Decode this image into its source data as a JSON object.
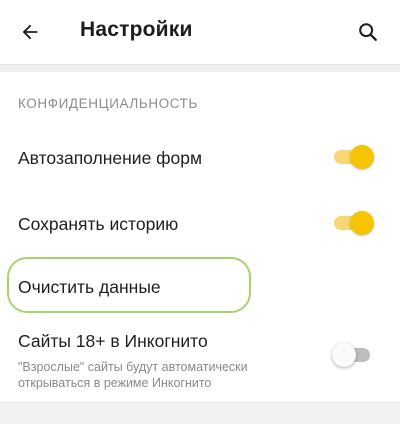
{
  "header": {
    "title": "Настройки",
    "back_icon": "arrow-left-icon",
    "search_icon": "search-icon"
  },
  "section": {
    "title": "КОНФИДЕНЦИАЛЬНОСТЬ"
  },
  "settings": {
    "autofill": {
      "label": "Автозаполнение форм",
      "enabled": true
    },
    "history": {
      "label": "Сохранять историю",
      "enabled": true
    },
    "clear_data": {
      "label": "Очистить данные"
    },
    "adult_incognito": {
      "label": "Сайты 18+ в Инкогнито",
      "description": "\"Взрослые\" сайты будут автоматически открываться в режиме Инкогнито",
      "enabled": false
    }
  },
  "colors": {
    "toggle_on_knob": "#f6c400",
    "toggle_on_track": "#f7d774",
    "toggle_off_track": "#bdbdbd",
    "highlight": "#a8d26a"
  }
}
